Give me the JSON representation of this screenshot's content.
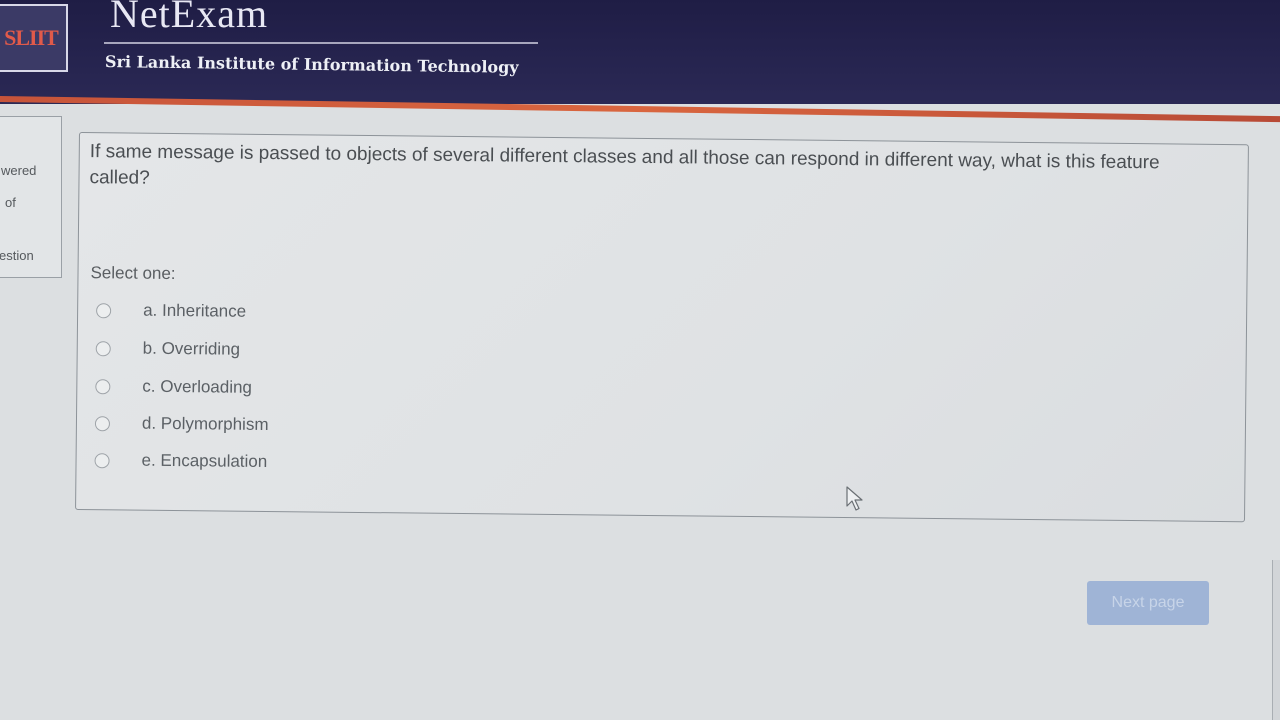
{
  "header": {
    "logo_text": "SLIIT",
    "brand_title": "NetExam",
    "brand_subtitle": "Sri Lanka Institute of Information Technology"
  },
  "side_panel": {
    "line1": "wered",
    "line2": "of",
    "line3": "estion"
  },
  "question": {
    "text": "If same message is passed to objects of several different classes and all those can respond in different way, what is this feature called?",
    "prompt": "Select one:",
    "options": [
      {
        "label": "a. Inheritance",
        "selected": false
      },
      {
        "label": "b. Overriding",
        "selected": false
      },
      {
        "label": "c. Overloading",
        "selected": false
      },
      {
        "label": "d. Polymorphism",
        "selected": false
      },
      {
        "label": "e. Encapsulation",
        "selected": false
      }
    ]
  },
  "navigation": {
    "next_label": "Next page"
  },
  "colors": {
    "header_bg": "#26244f",
    "accent_stripe": "#d9663f",
    "button_bg": "#9fb4d6"
  }
}
